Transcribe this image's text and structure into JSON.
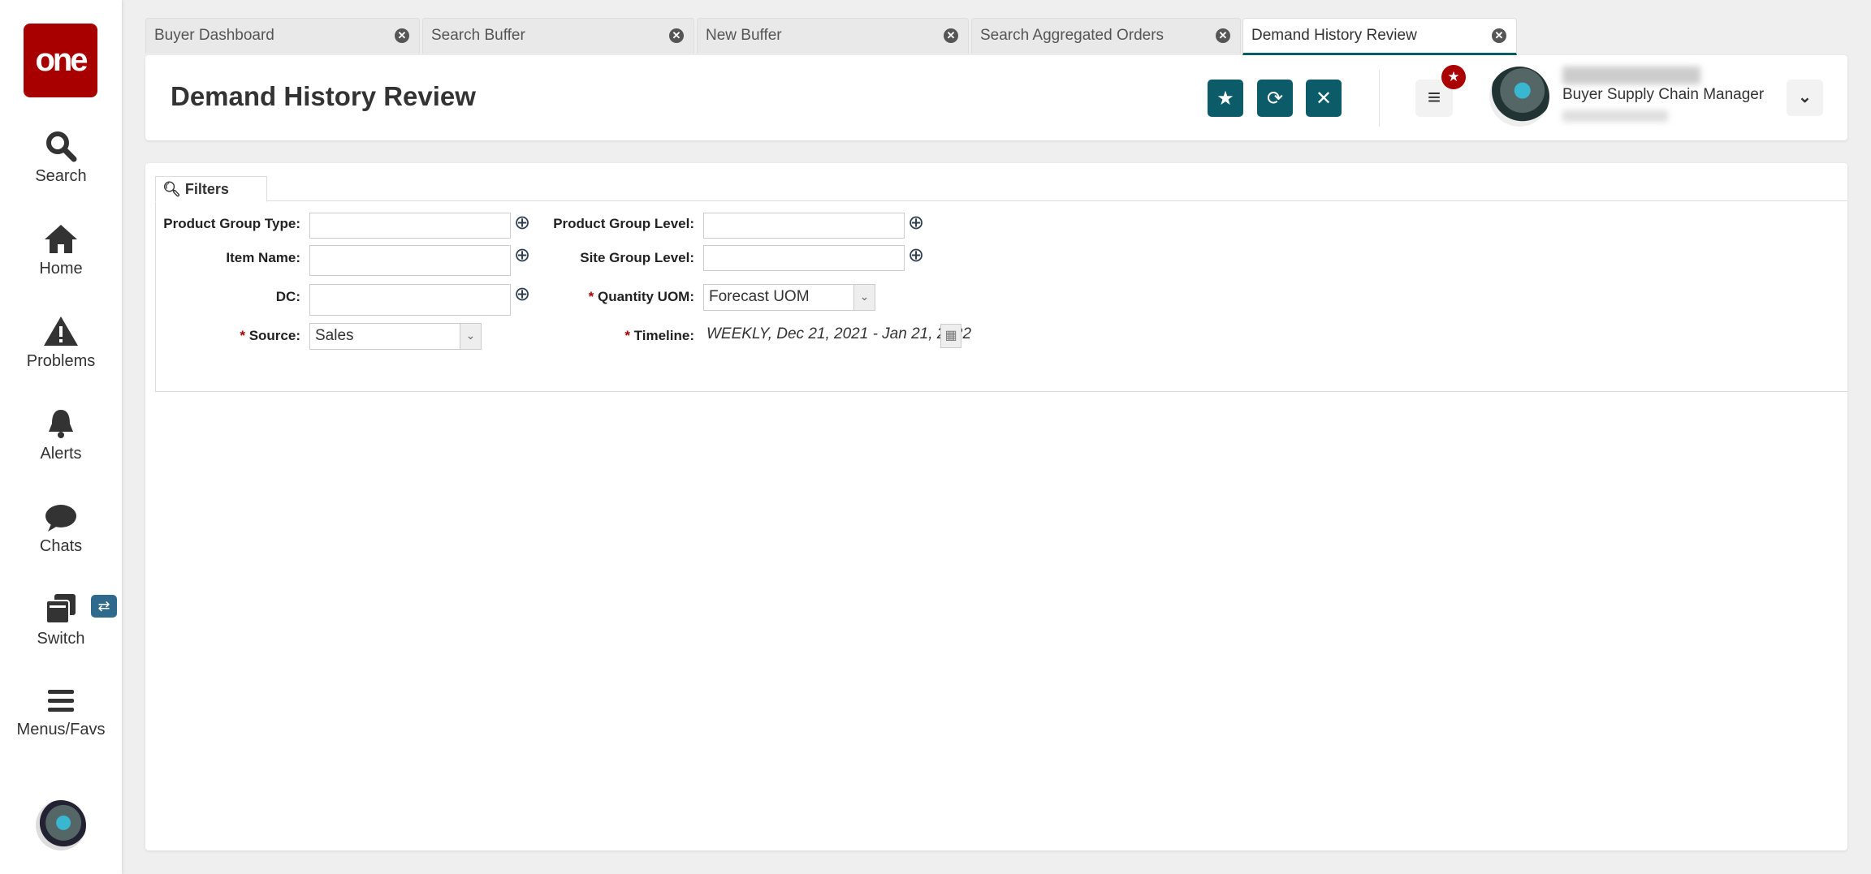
{
  "sidebar": {
    "logo": "one",
    "items": [
      {
        "label": "Search",
        "icon": "search-icon"
      },
      {
        "label": "Home",
        "icon": "home-icon"
      },
      {
        "label": "Problems",
        "icon": "warning-icon"
      },
      {
        "label": "Alerts",
        "icon": "bell-icon"
      },
      {
        "label": "Chats",
        "icon": "chat-icon"
      },
      {
        "label": "Switch",
        "icon": "switch-icon"
      },
      {
        "label": "Menus/Favs",
        "icon": "menu-icon"
      }
    ]
  },
  "tabs": [
    {
      "label": "Buyer Dashboard"
    },
    {
      "label": "Search Buffer"
    },
    {
      "label": "New Buffer"
    },
    {
      "label": "Search Aggregated Orders"
    },
    {
      "label": "Demand History Review",
      "active": true
    }
  ],
  "header": {
    "title": "Demand History Review",
    "user_role": "Buyer Supply Chain Manager"
  },
  "filters": {
    "tab_label": "Filters",
    "product_group_type": {
      "label": "Product Group Type:",
      "value": ""
    },
    "item_name": {
      "label": "Item Name:",
      "value": ""
    },
    "dc": {
      "label": "DC:",
      "value": ""
    },
    "source": {
      "label": "Source:",
      "value": "Sales"
    },
    "product_group_level": {
      "label": "Product Group Level:",
      "value": ""
    },
    "site_group_level": {
      "label": "Site Group Level:",
      "value": ""
    },
    "quantity_uom": {
      "label": "Quantity UOM:",
      "value": "Forecast UOM"
    },
    "timeline": {
      "label": "Timeline:",
      "value": "WEEKLY, Dec 21, 2021 - Jan 21, 2022"
    },
    "required_mark": "*"
  },
  "colors": {
    "brand": "#a80000",
    "accent": "#0c5b69"
  }
}
